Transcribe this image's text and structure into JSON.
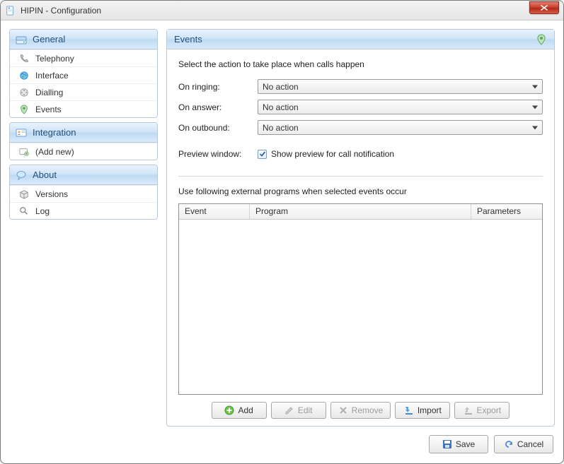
{
  "window": {
    "title": "HIPIN - Configuration"
  },
  "sidebar": {
    "groups": [
      {
        "name": "general",
        "label": "General",
        "items": [
          {
            "name": "telephony",
            "label": "Telephony"
          },
          {
            "name": "interface",
            "label": "Interface"
          },
          {
            "name": "dialling",
            "label": "Dialling"
          },
          {
            "name": "events",
            "label": "Events"
          }
        ]
      },
      {
        "name": "integration",
        "label": "Integration",
        "items": [
          {
            "name": "add-new",
            "label": "(Add new)"
          }
        ]
      },
      {
        "name": "about",
        "label": "About",
        "items": [
          {
            "name": "versions",
            "label": "Versions"
          },
          {
            "name": "log",
            "label": "Log"
          }
        ]
      }
    ]
  },
  "main": {
    "title": "Events",
    "instruction": "Select the action to take place when calls happen",
    "fields": {
      "on_ringing": {
        "label": "On ringing:",
        "value": "No action"
      },
      "on_answer": {
        "label": "On answer:",
        "value": "No action"
      },
      "on_outbound": {
        "label": "On outbound:",
        "value": "No action"
      }
    },
    "preview": {
      "label": "Preview window:",
      "checkbox_label": "Show preview for call notification",
      "checked": true
    },
    "programs": {
      "instruction": "Use following external programs when selected events occur",
      "columns": {
        "event": "Event",
        "program": "Program",
        "parameters": "Parameters"
      },
      "rows": []
    },
    "buttons": {
      "add": "Add",
      "edit": "Edit",
      "remove": "Remove",
      "import": "Import",
      "export": "Export"
    }
  },
  "footer": {
    "save": "Save",
    "cancel": "Cancel"
  }
}
